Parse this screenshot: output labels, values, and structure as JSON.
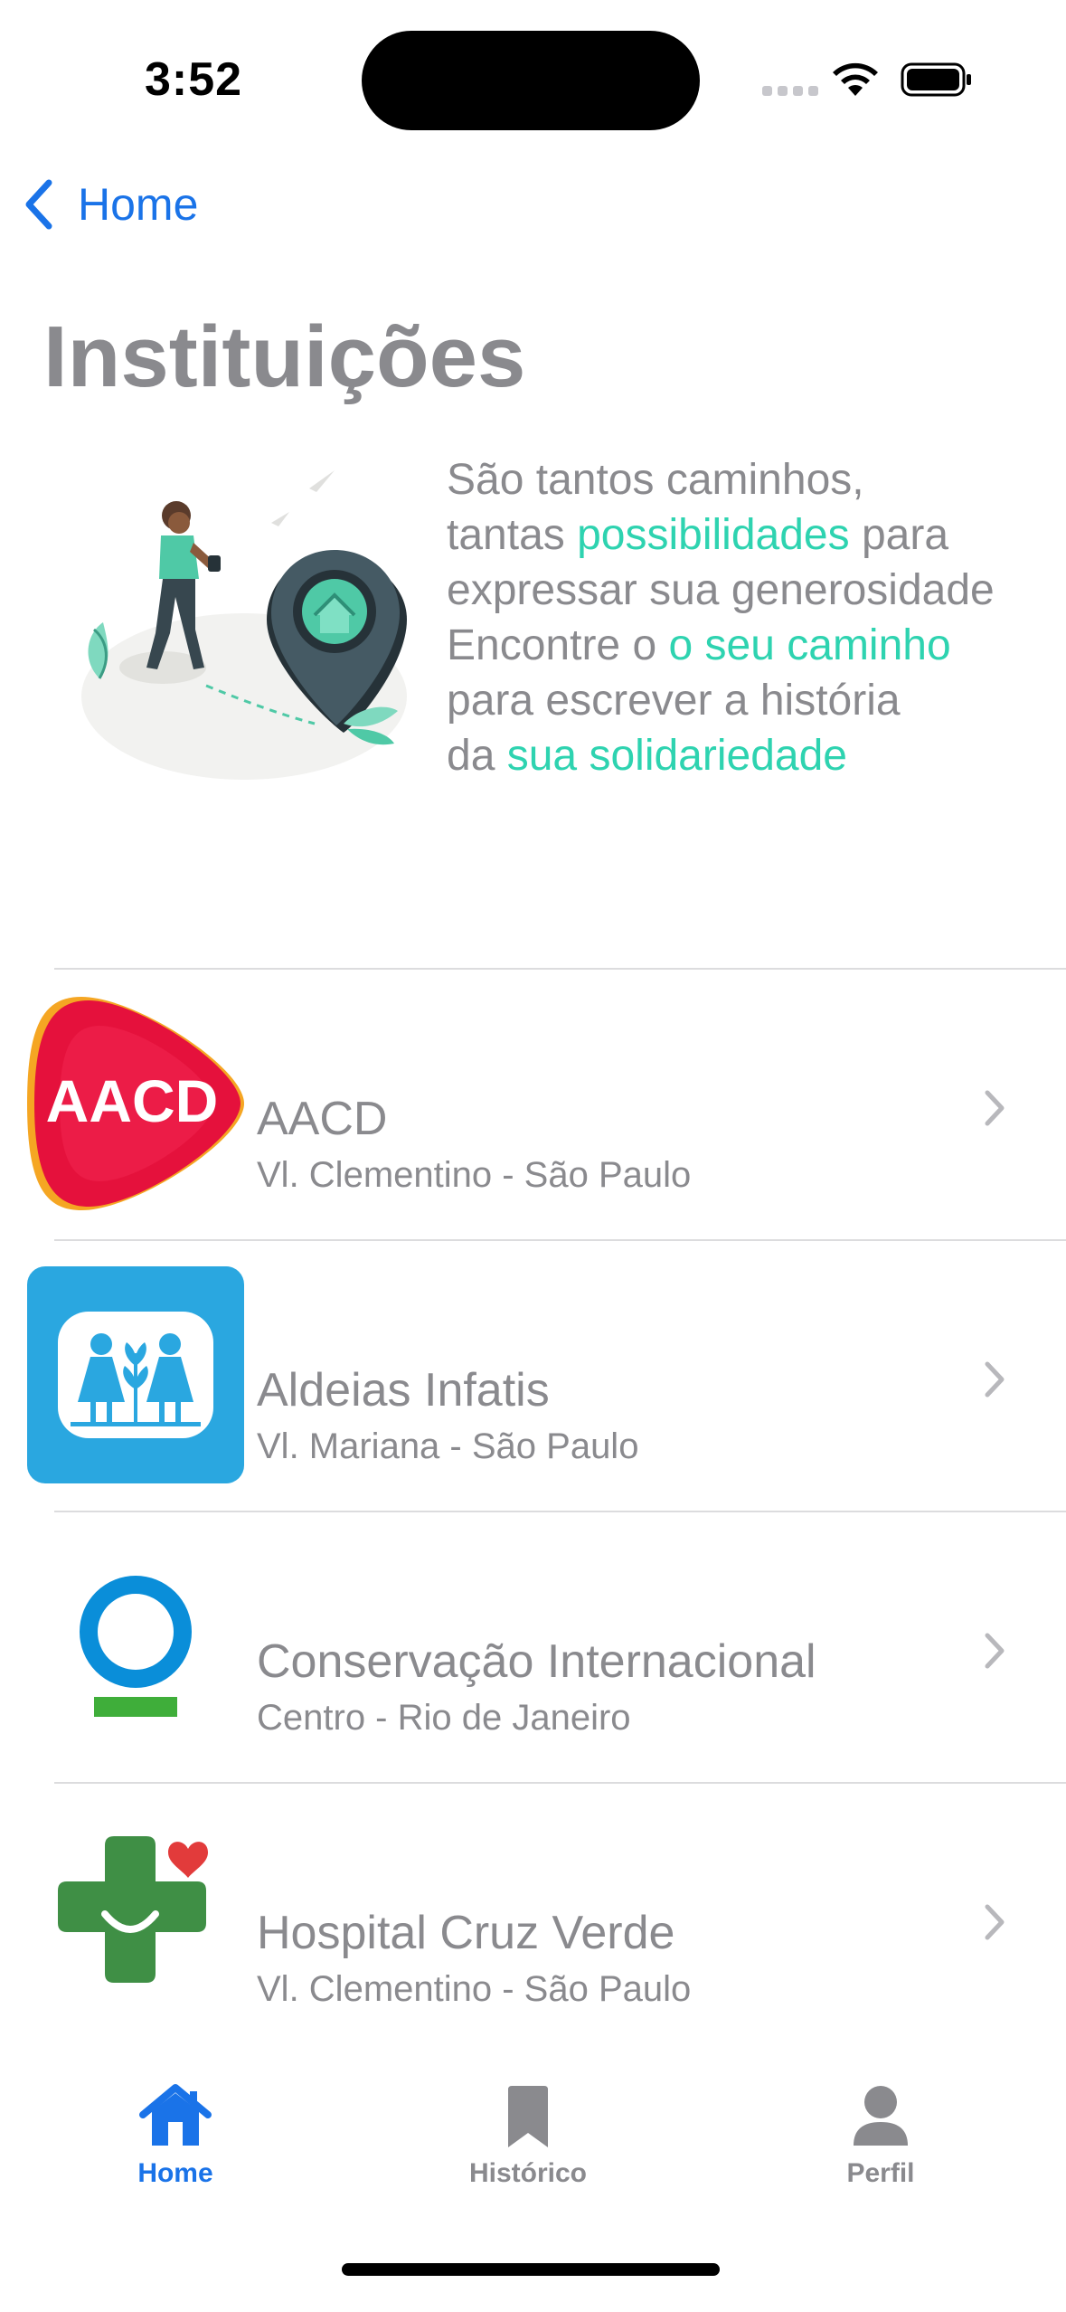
{
  "status": {
    "time": "3:52"
  },
  "nav": {
    "back_label": "Home"
  },
  "page": {
    "title": "Instituições"
  },
  "hero": {
    "line1": "São tantos caminhos,",
    "line2_pre": "tantas ",
    "line2_hl": "possibilidades",
    "line2_post": " para",
    "line3": "expressar sua generosidade",
    "line4_pre": "Encontre o ",
    "line4_hl": "o seu caminho",
    "line5": "para escrever a história",
    "line6_pre": "da ",
    "line6_hl": "sua solidariedade"
  },
  "institutions": [
    {
      "name": "AACD",
      "location": "Vl. Clementino - São Paulo",
      "logo_text": "AACD",
      "icon": "aacd-logo-icon"
    },
    {
      "name": "Aldeias Infatis",
      "location": "Vl. Mariana - São Paulo",
      "icon": "aldeias-logo-icon"
    },
    {
      "name": "Conservação Internacional",
      "location": "Centro - Rio de Janeiro",
      "icon": "conservacao-logo-icon"
    },
    {
      "name": "Hospital Cruz Verde",
      "location": "Vl. Clementino - São Paulo",
      "icon": "cruz-verde-logo-icon"
    }
  ],
  "tabs": [
    {
      "label": "Home",
      "icon": "house-icon",
      "active": true
    },
    {
      "label": "Histórico",
      "icon": "bookmark-icon",
      "active": false
    },
    {
      "label": "Perfil",
      "icon": "person-icon",
      "active": false
    }
  ],
  "colors": {
    "accent": "#1a73e8",
    "highlight": "#2ed3b0",
    "text": "#8a8a8e"
  }
}
